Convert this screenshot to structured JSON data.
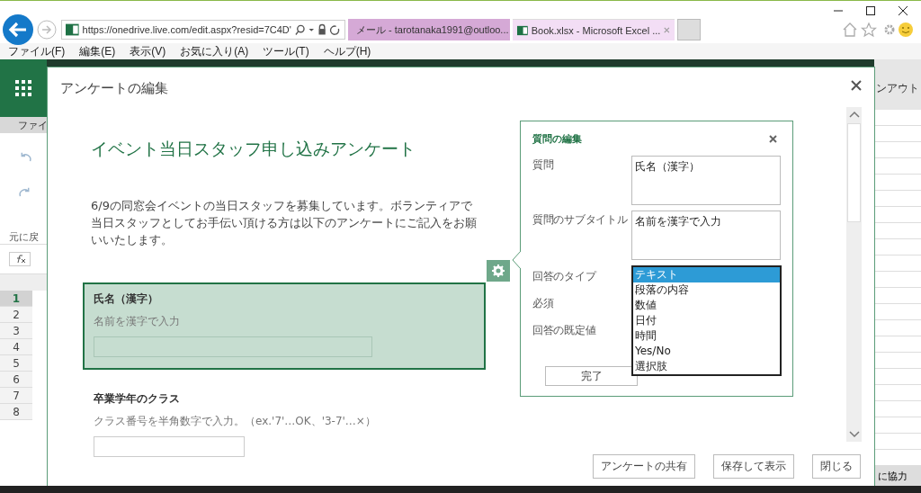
{
  "browser": {
    "address": "https://onedrive.live.com/edit.aspx?resid=7C4D'",
    "tabs": [
      {
        "title": "メール - tarotanaka1991@outloo...",
        "kind": "mail",
        "selected": false
      },
      {
        "title": "Book.xlsx - Microsoft Excel ...",
        "kind": "sheet",
        "selected": true
      }
    ],
    "menu": [
      "ファイル(F)",
      "編集(E)",
      "表示(V)",
      "お気に入り(A)",
      "ツール(T)",
      "ヘルプ(H)"
    ]
  },
  "excel": {
    "ribbon_tab": "ファイ",
    "undo_label": "元に戻",
    "sign_out": "ンアウト",
    "footer_text": "に協力",
    "rows": [
      {
        "label": "1",
        "selected": true
      },
      {
        "label": "2",
        "selected": false
      },
      {
        "label": "3",
        "selected": false
      },
      {
        "label": "4",
        "selected": false
      },
      {
        "label": "5",
        "selected": false
      },
      {
        "label": "6",
        "selected": false
      },
      {
        "label": "7",
        "selected": false
      },
      {
        "label": "8",
        "selected": false
      }
    ]
  },
  "dialog": {
    "title": "アンケートの編集",
    "form": {
      "title": "イベント当日スタッフ申し込みアンケート",
      "description": "6/9の同窓会イベントの当日スタッフを募集しています。ボランティアで当日スタッフとしてお手伝い頂ける方は以下のアンケートにご記入をお願いいたします。",
      "questions": [
        {
          "label": "氏名（漢字）",
          "hint": "名前を漢字で入力",
          "selected": true
        },
        {
          "label": "卒業学年のクラス",
          "hint": "クラス番号を半角数字で入力。（ex.'7'…OK、'3-7'…×）",
          "selected": false
        }
      ]
    },
    "editor": {
      "title": "質問の編集",
      "fields": [
        {
          "label": "質問",
          "kind": "textarea",
          "value": "氏名（漢字）"
        },
        {
          "label": "質問のサブタイトル",
          "kind": "textarea",
          "value": "名前を漢字で入力"
        },
        {
          "label": "回答のタイプ",
          "kind": "select"
        },
        {
          "label": "必須",
          "kind": "plain"
        },
        {
          "label": "回答の既定値",
          "kind": "plain"
        }
      ],
      "options": [
        {
          "label": "テキスト",
          "selected": true
        },
        {
          "label": "段落の内容",
          "selected": false
        },
        {
          "label": "数値",
          "selected": false
        },
        {
          "label": "日付",
          "selected": false
        },
        {
          "label": "時間",
          "selected": false
        },
        {
          "label": "Yes/No",
          "selected": false
        },
        {
          "label": "選択肢",
          "selected": false
        }
      ],
      "done_button": "完了"
    },
    "buttons": [
      "アンケートの共有",
      "保存して表示",
      "閉じる"
    ]
  }
}
